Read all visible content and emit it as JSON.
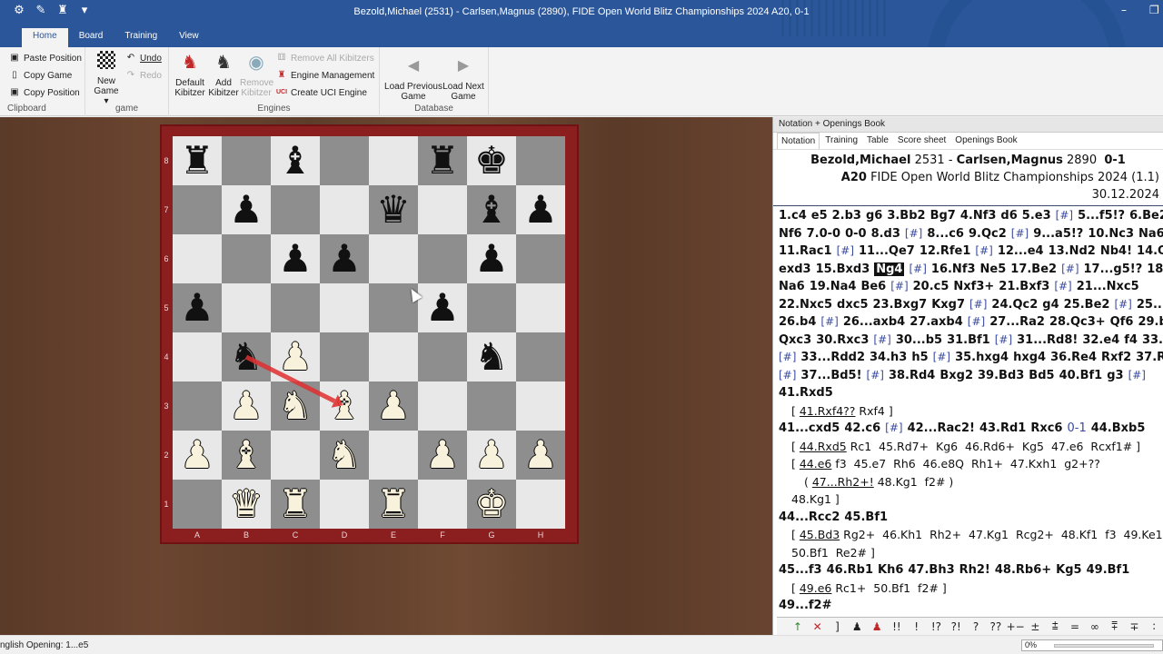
{
  "window": {
    "title": "Bezold,Michael (2531) - Carlsen,Magnus (2890), FIDE Open World Blitz Championships 2024  A20, 0-1",
    "minimize": "–",
    "restore": "❐",
    "qat": [
      "⚙",
      "✎",
      "♜",
      "▾"
    ]
  },
  "tabs": [
    "Home",
    "Board",
    "Training",
    "View"
  ],
  "ribbon": {
    "clipboard": {
      "label": "Clipboard",
      "paste_position": "Paste Position",
      "copy_game": "Copy Game",
      "copy_position": "Copy Position"
    },
    "game": {
      "label": "game",
      "new_game_1": "New",
      "new_game_2": "Game ▾",
      "undo": "Undo",
      "redo": "Redo"
    },
    "engines": {
      "label": "Engines",
      "default_kibitzer_1": "Default",
      "default_kibitzer_2": "Kibitzer",
      "add_kibitzer_1": "Add",
      "add_kibitzer_2": "Kibitzer",
      "remove_kibitzer_1": "Remove",
      "remove_kibitzer_2": "Kibitzer",
      "remove_all": "Remove All Kibitzers",
      "engine_management": "Engine Management",
      "create_uci": "Create UCI Engine"
    },
    "database": {
      "label": "Database",
      "load_prev_1": "Load Previous",
      "load_prev_2": "Game",
      "load_next_1": "Load Next",
      "load_next_2": "Game"
    }
  },
  "board": {
    "ranks": [
      "8",
      "7",
      "6",
      "5",
      "4",
      "3",
      "2",
      "1"
    ],
    "files": [
      "A",
      "B",
      "C",
      "D",
      "E",
      "F",
      "G",
      "H"
    ],
    "position": [
      [
        "r",
        "",
        "b",
        "",
        "",
        "r",
        "k",
        ""
      ],
      [
        "",
        "p",
        "",
        "",
        "q",
        "",
        "b",
        "p"
      ],
      [
        "",
        "",
        "p",
        "p",
        "",
        "",
        "p",
        ""
      ],
      [
        "p",
        "",
        "",
        "",
        "",
        "p",
        "",
        ""
      ],
      [
        "",
        "n",
        "P",
        "",
        "",
        "",
        "n",
        ""
      ],
      [
        "",
        "P",
        "N",
        "B",
        "P",
        "",
        "",
        ""
      ],
      [
        "P",
        "B",
        "",
        "N",
        "",
        "P",
        "P",
        "P"
      ],
      [
        "",
        "Q",
        "R",
        "",
        "R",
        "",
        "K",
        ""
      ]
    ],
    "arrow": {
      "from": "b4",
      "to": "d3",
      "color": "#e03030"
    }
  },
  "panel": {
    "title": "Notation + Openings Book",
    "tabs": [
      "Notation",
      "Training",
      "Table",
      "Score sheet",
      "Openings Book"
    ],
    "white": "Bezold,Michael",
    "white_elo": "2531",
    "black": "Carlsen,Magnus",
    "black_elo": "2890",
    "result": "0-1",
    "eco": "A20",
    "event": "FIDE Open World Blitz Championships 2024 (1.1) 30.12.2024",
    "symbols": [
      "↑",
      "✕",
      "]",
      "♟",
      "♟",
      "!!",
      "!",
      "!?",
      "?!",
      "?",
      "??",
      "+−",
      "±",
      "⩲",
      "=",
      "∞",
      "⩱",
      "∓",
      "∶"
    ]
  },
  "status": {
    "text": "nglish Opening: 1...e5",
    "progress_label": "0%",
    "progress_value": 0
  }
}
